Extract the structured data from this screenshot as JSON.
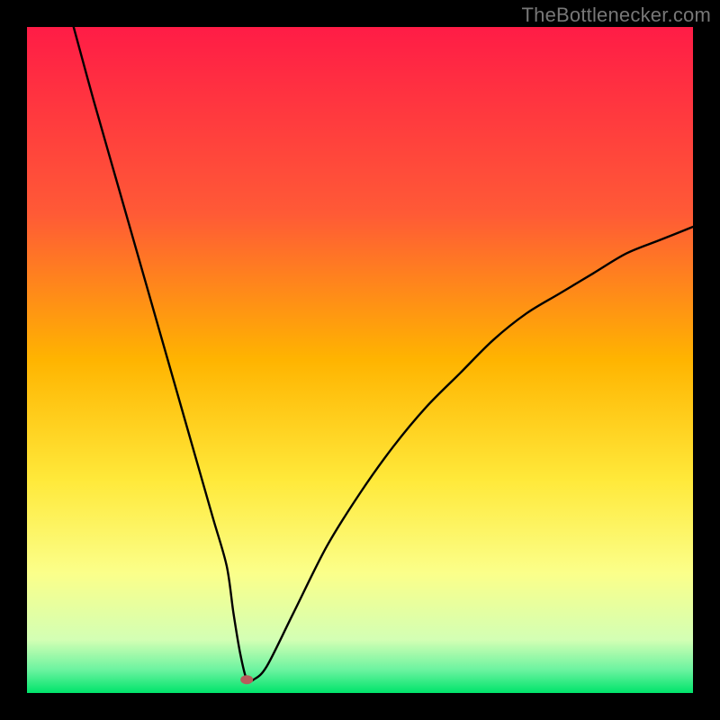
{
  "watermark": {
    "text": "TheBottlenecker.com"
  },
  "chart_data": {
    "type": "line",
    "title": "",
    "xlabel": "",
    "ylabel": "",
    "xlim": [
      0,
      100
    ],
    "ylim": [
      0,
      100
    ],
    "grid": false,
    "background": "rainbow-gradient",
    "series": [
      {
        "name": "bottleneck-curve",
        "x": [
          7,
          10,
          14,
          18,
          22,
          26,
          28,
          30,
          31,
          32,
          33,
          34,
          36,
          40,
          45,
          50,
          55,
          60,
          65,
          70,
          75,
          80,
          85,
          90,
          95,
          100
        ],
        "y": [
          100,
          89,
          75,
          61,
          47,
          33,
          26,
          19,
          12,
          6,
          2,
          2,
          4,
          12,
          22,
          30,
          37,
          43,
          48,
          53,
          57,
          60,
          63,
          66,
          68,
          70
        ]
      }
    ],
    "marker": {
      "x": 33,
      "y": 2,
      "color": "#b85c5c"
    },
    "gradient_stops": [
      {
        "offset": 0,
        "color": "#ff1c46"
      },
      {
        "offset": 0.28,
        "color": "#ff5a36"
      },
      {
        "offset": 0.5,
        "color": "#ffb400"
      },
      {
        "offset": 0.68,
        "color": "#ffe93a"
      },
      {
        "offset": 0.82,
        "color": "#fbff8a"
      },
      {
        "offset": 0.92,
        "color": "#d3ffb4"
      },
      {
        "offset": 0.965,
        "color": "#6cf3a0"
      },
      {
        "offset": 1.0,
        "color": "#00e46b"
      }
    ]
  }
}
